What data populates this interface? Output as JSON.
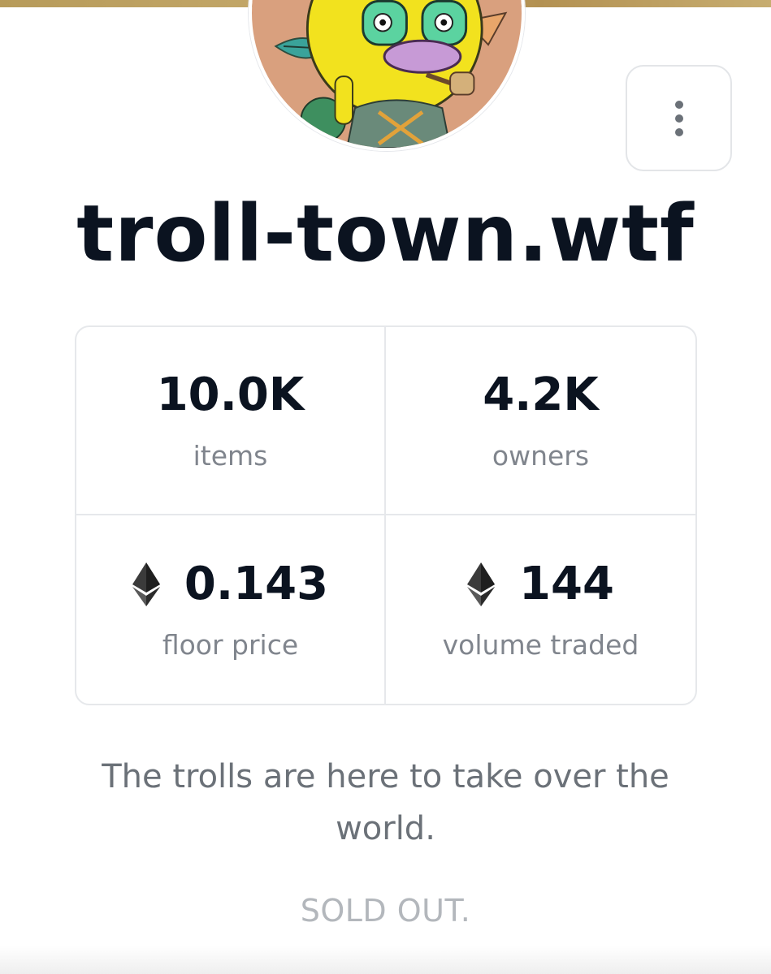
{
  "collection": {
    "name": "troll-town.wtf",
    "description": "The trolls are here to take over the world.",
    "status": "SOLD OUT."
  },
  "avatar": {
    "icon": "troll-avatar-image",
    "colors": {
      "background": "#d9a07e",
      "skin": "#f2e21e",
      "nose": "#c79ad6",
      "eyes": "#5bd3a0"
    }
  },
  "menu": {
    "icon": "more-vertical-icon"
  },
  "stats": {
    "items": {
      "value": "10.0K",
      "label": "items"
    },
    "owners": {
      "value": "4.2K",
      "label": "owners"
    },
    "floor_price": {
      "value": "0.143",
      "label": "floor price",
      "icon": "ethereum-icon"
    },
    "volume_traded": {
      "value": "144",
      "label": "volume traded",
      "icon": "ethereum-icon"
    }
  },
  "theme": {
    "banner": "#bfa264",
    "text_primary": "#0b1320",
    "text_secondary": "#80858d",
    "border": "#e6e8eb"
  }
}
